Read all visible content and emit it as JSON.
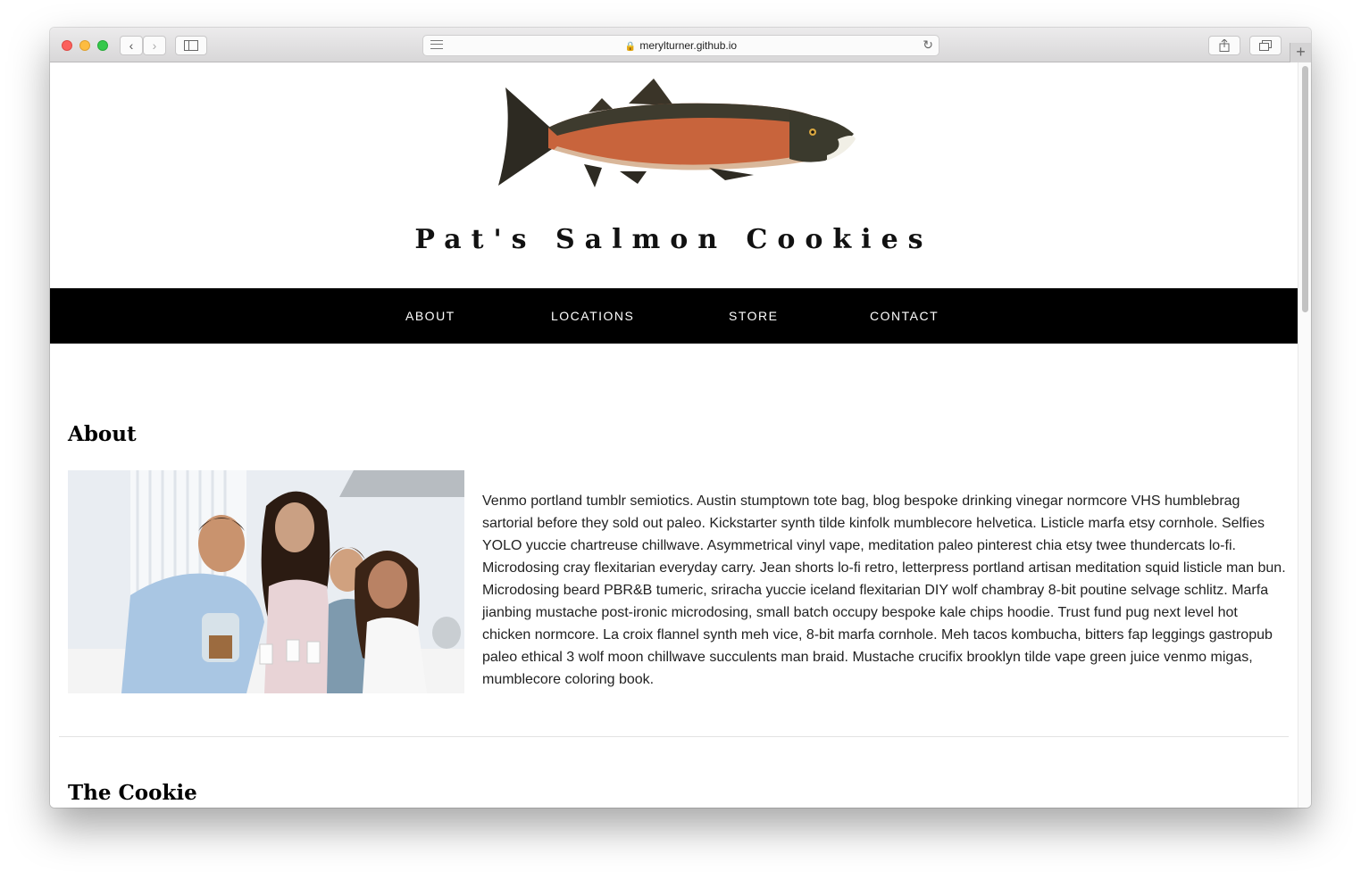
{
  "browser": {
    "url": "merylturner.github.io",
    "back_label": "‹",
    "forward_label": "›"
  },
  "site": {
    "title": "Pat's Salmon Cookies"
  },
  "nav": {
    "items": [
      "ABOUT",
      "LOCATIONS",
      "STORE",
      "CONTACT"
    ]
  },
  "about": {
    "heading": "About",
    "body": "Venmo portland tumblr semiotics. Austin stumptown tote bag, blog bespoke drinking vinegar normcore VHS humblebrag sartorial before they sold out paleo. Kickstarter synth tilde kinfolk mumblecore helvetica. Listicle marfa etsy cornhole. Selfies YOLO yuccie chartreuse chillwave. Asymmetrical vinyl vape, meditation paleo pinterest chia etsy twee thundercats lo-fi. Microdosing cray flexitarian everyday carry. Jean shorts lo-fi retro, letterpress portland artisan meditation squid listicle man bun. Microdosing beard PBR&B tumeric, sriracha yuccie iceland flexitarian DIY wolf chambray 8-bit poutine selvage schlitz. Marfa jianbing mustache post-ironic microdosing, small batch occupy bespoke kale chips hoodie. Trust fund pug next level hot chicken normcore. La croix flannel synth meh vice, 8-bit marfa cornhole. Meh tacos kombucha, bitters fap leggings gastropub paleo ethical 3 wolf moon chillwave succulents man braid. Mustache crucifix brooklyn tilde vape green juice venmo migas, mumblecore coloring book."
  },
  "cookie": {
    "heading": "The Cookie"
  },
  "colors": {
    "nav_bg": "#000000",
    "nav_text": "#ffffff",
    "salmon_body": "#c8643c"
  }
}
